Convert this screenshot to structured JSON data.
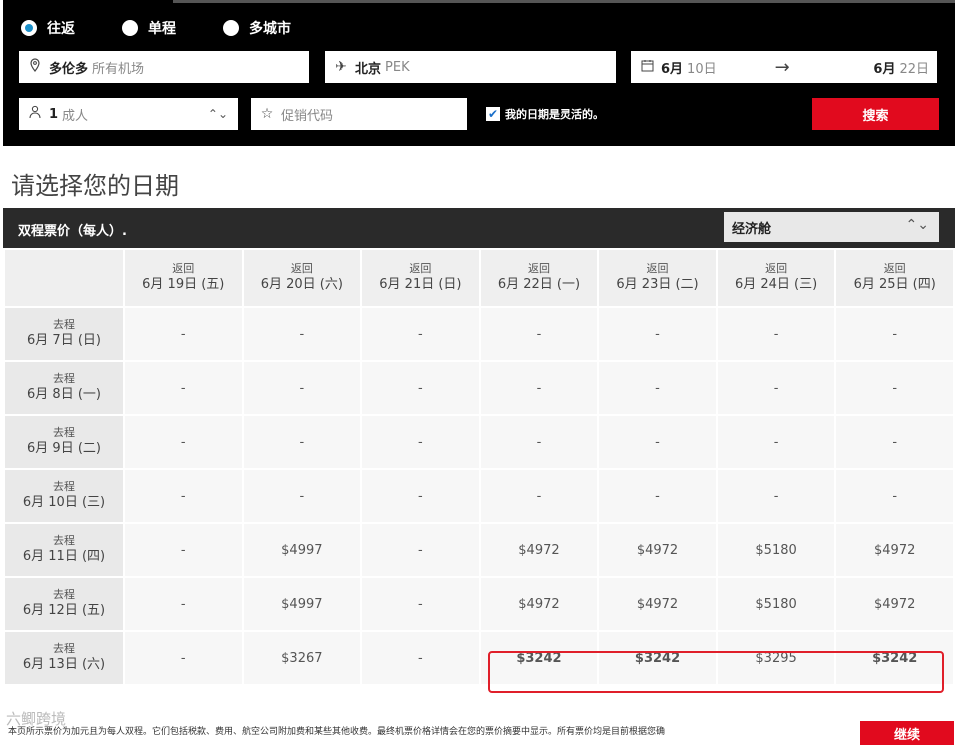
{
  "search": {
    "trip_types": [
      {
        "label": "往返",
        "selected": true
      },
      {
        "label": "单程",
        "selected": false
      },
      {
        "label": "多城市",
        "selected": false
      }
    ],
    "origin": {
      "city": "多伦多",
      "detail": "所有机场"
    },
    "destination": {
      "city": "北京",
      "detail": "PEK"
    },
    "depart": {
      "month": "6月",
      "day": "10日"
    },
    "return": {
      "month": "6月",
      "day": "22日"
    },
    "passengers": {
      "count": "1",
      "label": "成人"
    },
    "promo_placeholder": "促销代码",
    "flexible_label": "我的日期是灵活的。",
    "flexible_checked": true,
    "search_button": "搜索"
  },
  "page_title": "请选择您的日期",
  "grid": {
    "title": "双程票价（每人）.",
    "cabin": "经济舱",
    "return_label": "返回",
    "depart_label": "去程",
    "return_dates": [
      "6月 19日 (五)",
      "6月 20日 (六)",
      "6月 21日 (日)",
      "6月 22日 (一)",
      "6月 23日 (二)",
      "6月 24日 (三)",
      "6月 25日 (四)"
    ],
    "rows": [
      {
        "date": "6月 7日 (日)",
        "fares": [
          "-",
          "-",
          "-",
          "-",
          "-",
          "-",
          "-"
        ]
      },
      {
        "date": "6月 8日 (一)",
        "fares": [
          "-",
          "-",
          "-",
          "-",
          "-",
          "-",
          "-"
        ]
      },
      {
        "date": "6月 9日 (二)",
        "fares": [
          "-",
          "-",
          "-",
          "-",
          "-",
          "-",
          "-"
        ]
      },
      {
        "date": "6月 10日 (三)",
        "fares": [
          "-",
          "-",
          "-",
          "-",
          "-",
          "-",
          "-"
        ]
      },
      {
        "date": "6月 11日 (四)",
        "fares": [
          "-",
          "$4997",
          "-",
          "$4972",
          "$4972",
          "$5180",
          "$4972"
        ]
      },
      {
        "date": "6月 12日 (五)",
        "fares": [
          "-",
          "$4997",
          "-",
          "$4972",
          "$4972",
          "$5180",
          "$4972"
        ]
      },
      {
        "date": "6月 13日 (六)",
        "fares": [
          "-",
          "$3267",
          "-",
          "$3242",
          "$3242",
          "$3295",
          "$3242"
        ]
      }
    ],
    "lowest_fare": "$3242"
  },
  "footnote": "本页所示票价为加元且为每人双程。它们包括税款、费用、航空公司附加费和某些其他收费。最终机票价格详情会在您的票价摘要中显示。所有票价均是目前根据您确",
  "continue_button": "继续",
  "watermark": "六鲫跨境",
  "colors": {
    "accent_red": "#e10a1e",
    "panel_bg": "#000000",
    "radio_selected": "#1a8fc9"
  }
}
